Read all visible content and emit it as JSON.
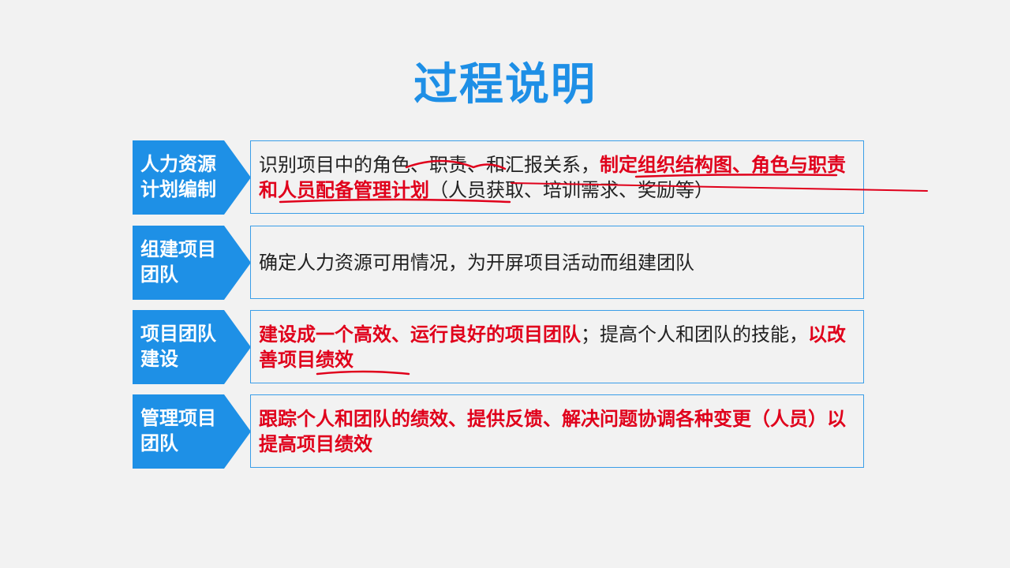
{
  "title": "过程说明",
  "rows": [
    {
      "label_line1": "人力资源",
      "label_line2": "计划编制",
      "text_plain": "识别项目中的角色、职责、和汇报关系，",
      "text_red": "制定组织结构图、角色与职责和人员配备管理计划",
      "text_tail": "（人员获取、培训需求、奖励等）"
    },
    {
      "label_line1": "组建项目",
      "label_line2": "团队",
      "text_plain": "确定人力资源可用情况，为开屏项目活动而组建团队"
    },
    {
      "label_line1": "项目团队",
      "label_line2": "建设",
      "text_red": "建设成一个高效、运行良好的项目团队",
      "text_mid": "；提高个人和团队的技能，",
      "text_red2": "以改善项目绩效"
    },
    {
      "label_line1": "管理项目",
      "label_line2": "团队",
      "text_red": "跟踪个人和团队的绩效、提供反馈、解决问题协调各种变更（人员）以提高项目绩效"
    }
  ],
  "colors": {
    "title": "#1e8fe6",
    "label_bg": "#1e90e6",
    "highlight_red": "#e0001b",
    "box_border": "#3a9ee8"
  }
}
